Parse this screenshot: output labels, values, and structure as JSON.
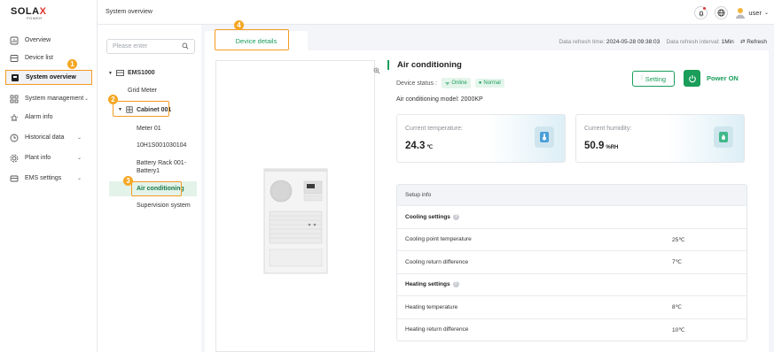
{
  "brand": {
    "logo_main": "SOLA",
    "logo_x": "X",
    "logo_sub": "POWER"
  },
  "sidebar": {
    "items": [
      {
        "label": "Overview",
        "icon": "overview-icon"
      },
      {
        "label": "Device list",
        "icon": "device-list-icon"
      },
      {
        "label": "System overview",
        "icon": "system-overview-icon",
        "active": true
      },
      {
        "label": "System management",
        "icon": "system-management-icon"
      },
      {
        "label": "Alarm info",
        "icon": "alarm-icon"
      },
      {
        "label": "Historical data",
        "icon": "history-icon"
      },
      {
        "label": "Plant info",
        "icon": "plant-icon"
      },
      {
        "label": "EMS settings",
        "icon": "ems-settings-icon"
      }
    ]
  },
  "header": {
    "breadcrumb": "System overview",
    "user": "user"
  },
  "tree": {
    "search_placeholder": "Please enter",
    "root": "EMS1000",
    "grid_meter": "Grid Meter",
    "cabinet": "Cabinet 001",
    "meter": "Meter 01",
    "serial": "10H1S001030104",
    "battery_line1": "Battery Rack 001-",
    "battery_line2": "Battery1",
    "air": "Air conditioning",
    "supervision": "Supervision system"
  },
  "callouts": [
    "1",
    "2",
    "3",
    "4"
  ],
  "tab": {
    "label": "Device details"
  },
  "refresh": {
    "time_label": "Data refresh time:",
    "time_value": "2024-05-28 09:38:03",
    "interval_label": "Data refresh interval:",
    "interval_value": "1Min",
    "refresh_label": "Refresh"
  },
  "device": {
    "title": "Air conditioning",
    "status_label": "Device status :",
    "status_online": "Online",
    "status_normal": "Normal",
    "model": "Air conditioning model:  2000KP",
    "setting_label": "Setting",
    "power_label": "Power ON"
  },
  "metrics": {
    "temperature": {
      "label": "Current temperature:",
      "value": "24.3",
      "unit": "℃"
    },
    "humidity": {
      "label": "Current humidity:",
      "value": "50.9",
      "unit": "%RH"
    }
  },
  "setup": {
    "title": "Setup info",
    "cooling_header": "Cooling settings",
    "cooling_point_label": "Cooling point temperature",
    "cooling_point_value": "25℃",
    "cooling_return_label": "Cooling return difference",
    "cooling_return_value": "7℃",
    "heating_header": "Heating settings",
    "heating_temp_label": "Heating temperature",
    "heating_temp_value": "8℃",
    "heating_return_label": "Heating return difference",
    "heating_return_value": "10℃"
  },
  "colors": {
    "accent": "#1a9e5a",
    "callout": "#f5a623",
    "alert_dot": "#e53935"
  }
}
